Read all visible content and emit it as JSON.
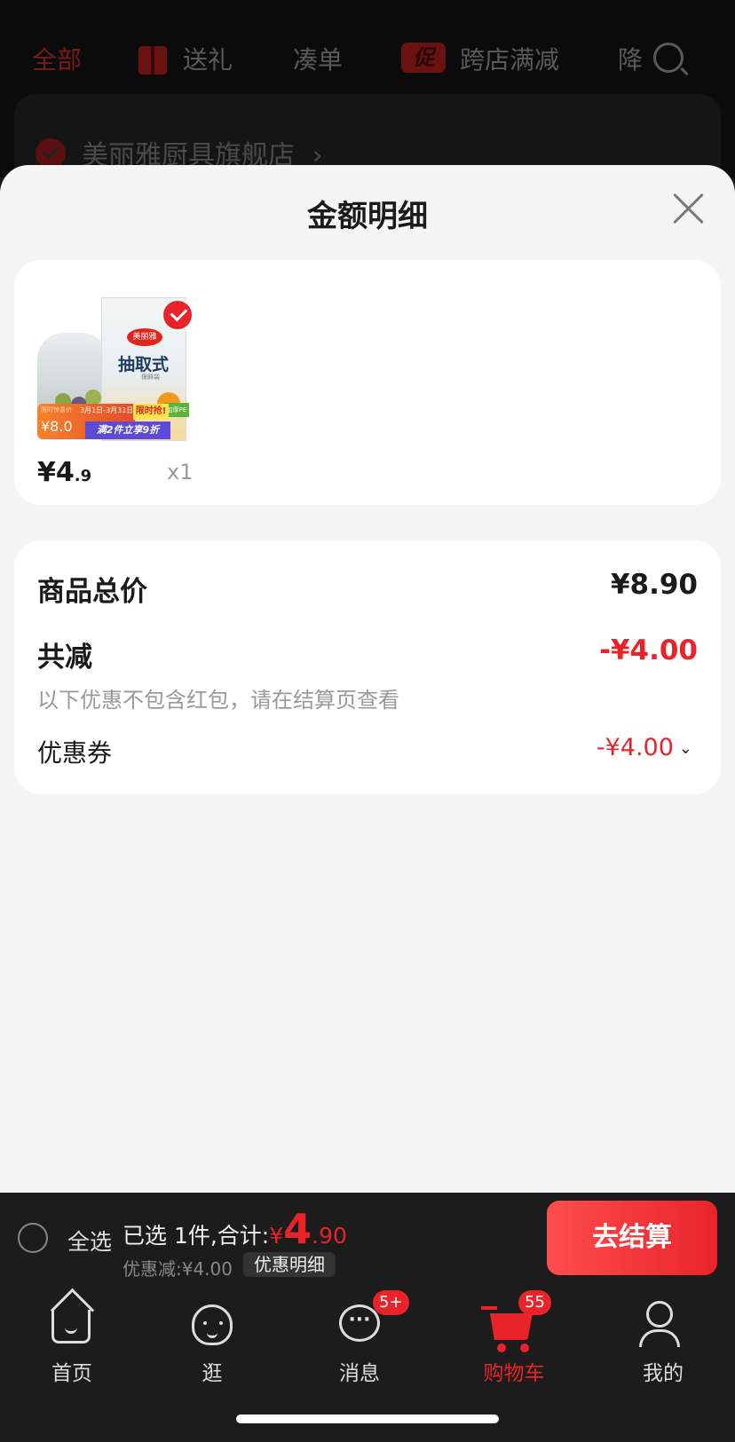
{
  "background": {
    "tabs": [
      {
        "label": "全部",
        "active": true
      },
      {
        "label": "送礼"
      },
      {
        "label": "凑单"
      },
      {
        "label": "跨店满减",
        "chip": "促"
      },
      {
        "label": "降"
      }
    ],
    "shop_name": "美丽雅厨具旗舰店",
    "shop_arrow": "›"
  },
  "sheet": {
    "title": "金额明细",
    "product": {
      "price_int": "¥4",
      "price_dec": ".9",
      "qty": "x1",
      "image_text": {
        "brand": "美丽雅",
        "name": "抽取式",
        "sub": "保鲜袋",
        "banner_label": "限时惊喜价",
        "banner_price": "¥8.0",
        "banner_date": "3月1日-3月31日",
        "banner_promo": "满2件立享9折",
        "banner_flash": "限时抢!",
        "green_tag": "加厚PE"
      }
    },
    "summary": {
      "total_label": "商品总价",
      "total_value": "¥8.90",
      "reduce_label": "共减",
      "reduce_value": "-¥4.00",
      "note": "以下优惠不包含红包，请在结算页查看",
      "coupon_label": "优惠券",
      "coupon_value": "-¥4.00",
      "coupon_chevron": "⌄"
    }
  },
  "checkout": {
    "select_all": "全选",
    "summary_prefix": "已选 1件,合计:",
    "currency": "¥",
    "amount_int": "4",
    "amount_dec": ".90",
    "discount": "优惠减:¥4.00",
    "detail_chip": "优惠明细",
    "submit": "去结算"
  },
  "tabbar": {
    "items": [
      {
        "label": "首页",
        "icon": "home-icon"
      },
      {
        "label": "逛",
        "icon": "stroll-icon"
      },
      {
        "label": "消息",
        "icon": "message-icon",
        "badge": "5+"
      },
      {
        "label": "购物车",
        "icon": "cart-icon",
        "badge": "55",
        "active": true
      },
      {
        "label": "我的",
        "icon": "profile-icon"
      }
    ]
  },
  "colors": {
    "accent_red": "#e8242a",
    "sheet_bg": "#f5f5f5",
    "bar_bg": "#1c1c1c"
  }
}
